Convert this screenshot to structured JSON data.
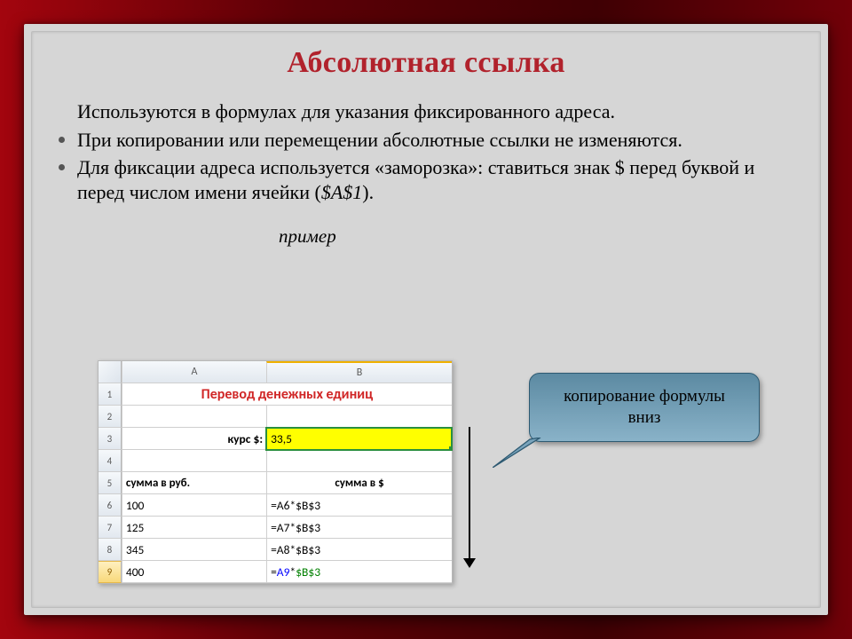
{
  "title": "Абсолютная ссылка",
  "bullets": {
    "line0": "Используются в формулах для указания фиксированного адреса.",
    "line1": "При копировании или перемещении абсолютные ссылки не изменяются.",
    "line2_a": "Для фиксации адреса используется «заморозка»: ставиться знак $ перед буквой и перед числом имени ячейки (",
    "line2_i": "$A$1",
    "line2_b": ")."
  },
  "example_label": "пример",
  "spreadsheet": {
    "col_headers": {
      "A": "A",
      "B": "B"
    },
    "row_nums": [
      "1",
      "2",
      "3",
      "4",
      "5",
      "6",
      "7",
      "8",
      "9"
    ],
    "merged_title": "Перевод денежных единиц",
    "r3": {
      "A": "курс $:",
      "B": "33,5"
    },
    "r5": {
      "A": "сумма в руб.",
      "B": "сумма в $"
    },
    "r6": {
      "A": "100",
      "B": "=A6*$B$3"
    },
    "r7": {
      "A": "125",
      "B": "=A7*$B$3"
    },
    "r8": {
      "A": "345",
      "B": "=A8*$B$3"
    },
    "r9": {
      "A": "400",
      "B_pre": "=",
      "B_ref1": "A9",
      "B_mid": "*",
      "B_ref2": "$B$3"
    }
  },
  "callout": {
    "line1": "копирование формулы",
    "line2": "вниз"
  }
}
